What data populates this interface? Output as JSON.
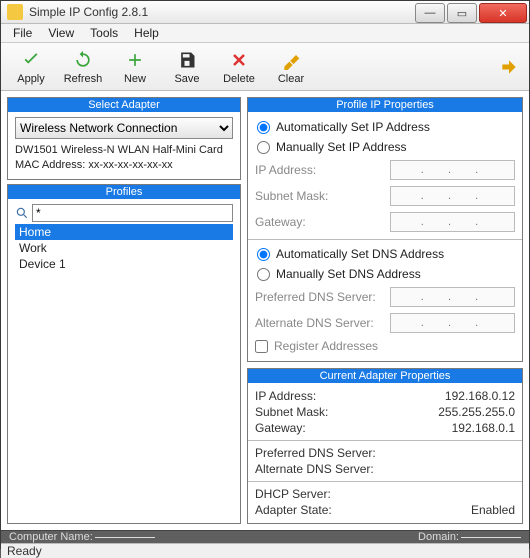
{
  "window": {
    "title": "Simple IP Config 2.8.1"
  },
  "menu": {
    "file": "File",
    "view": "View",
    "tools": "Tools",
    "help": "Help"
  },
  "toolbar": {
    "apply": "Apply",
    "refresh": "Refresh",
    "new": "New",
    "save": "Save",
    "delete": "Delete",
    "clear": "Clear"
  },
  "left": {
    "select_adapter_header": "Select Adapter",
    "adapter_selected": "Wireless Network Connection",
    "adapter_card": "DW1501 Wireless-N WLAN Half-Mini Card",
    "mac_label": "MAC Address: xx-xx-xx-xx-xx-xx",
    "profiles_header": "Profiles",
    "search_value": "*",
    "profiles": [
      {
        "name": "Home",
        "selected": true
      },
      {
        "name": "Work",
        "selected": false
      },
      {
        "name": "Device 1",
        "selected": false
      }
    ]
  },
  "ip_props": {
    "header": "Profile IP Properties",
    "auto_ip": "Automatically Set IP Address",
    "manual_ip": "Manually Set IP Address",
    "ip_address_label": "IP Address:",
    "subnet_label": "Subnet Mask:",
    "gateway_label": "Gateway:",
    "auto_dns": "Automatically Set DNS Address",
    "manual_dns": "Manually Set DNS Address",
    "pref_dns_label": "Preferred DNS Server:",
    "alt_dns_label": "Alternate DNS Server:",
    "register": "Register Addresses",
    "ip_placeholder": ".  .  ."
  },
  "cur_props": {
    "header": "Current Adapter Properties",
    "ip_label": "IP Address:",
    "ip_value": "192.168.0.12",
    "subnet_label": "Subnet Mask:",
    "subnet_value": "255.255.255.0",
    "gateway_label": "Gateway:",
    "gateway_value": "192.168.0.1",
    "pref_dns_label": "Preferred DNS Server:",
    "pref_dns_value": "",
    "alt_dns_label": "Alternate DNS Server:",
    "alt_dns_value": "",
    "dhcp_label": "DHCP Server:",
    "dhcp_value": "",
    "state_label": "Adapter State:",
    "state_value": "Enabled"
  },
  "status": {
    "computer_name_label": "Computer Name:",
    "domain_label": "Domain:",
    "ready": "Ready"
  }
}
